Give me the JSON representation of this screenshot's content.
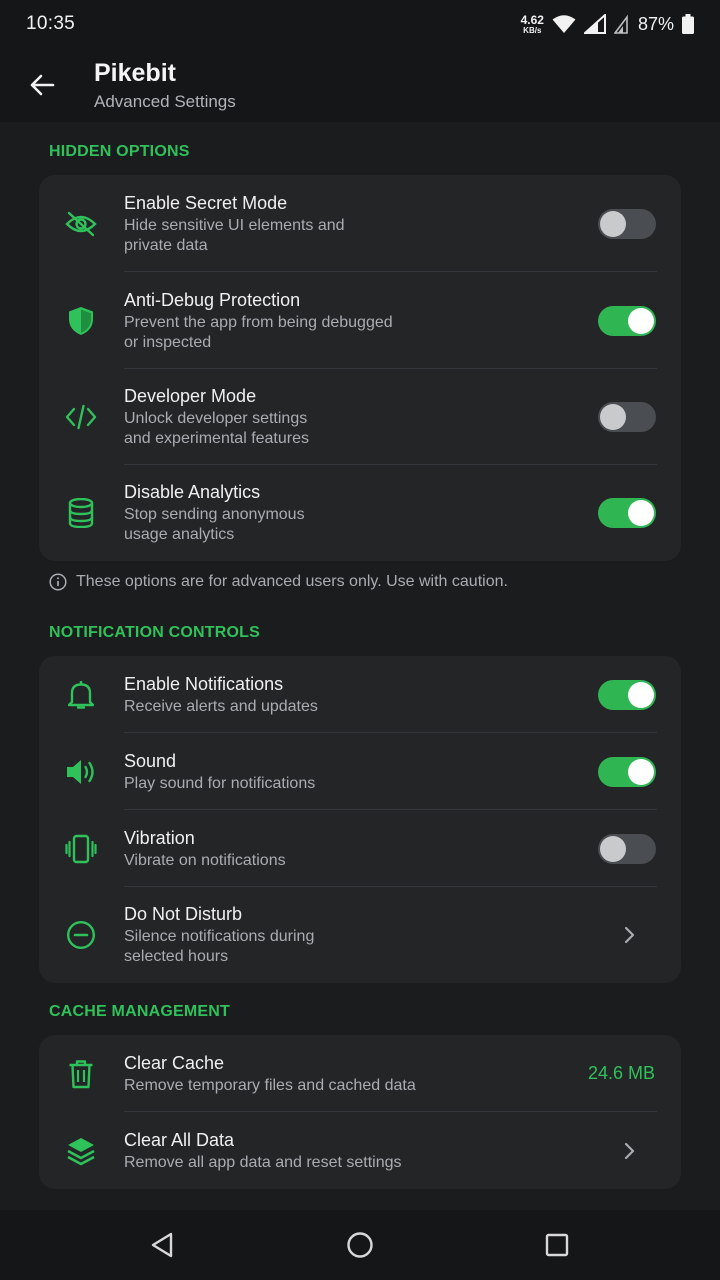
{
  "status": {
    "time": "10:35",
    "net_speed_value": "4.62",
    "net_speed_unit": "KB/s",
    "battery": "87%"
  },
  "appbar": {
    "title": "Pikebit",
    "subtitle": "Advanced Settings"
  },
  "hidden_options": {
    "header": "HIDDEN OPTIONS",
    "items": [
      {
        "label": "Enable Secret Mode",
        "desc1": "Hide sensitive UI elements and",
        "desc2": "private data",
        "icon": "eye-off-icon",
        "enabled": false
      },
      {
        "label": "Anti-Debug Protection",
        "desc1": "Prevent the app from being debugged",
        "desc2": "or inspected",
        "icon": "shield-icon",
        "enabled": true
      },
      {
        "label": "Developer Mode",
        "desc1": "Unlock developer settings",
        "desc2": "and experimental features",
        "icon": "code-icon",
        "enabled": false
      },
      {
        "label": "Disable Analytics",
        "desc1": "Stop sending anonymous",
        "desc2": "usage analytics",
        "icon": "database-icon",
        "enabled": true
      }
    ],
    "note": "These options are for advanced users only. Use with caution."
  },
  "notification_controls": {
    "header": "NOTIFICATION CONTROLS",
    "items": [
      {
        "label": "Enable Notifications",
        "desc1": "Receive alerts and updates",
        "icon": "bell-icon",
        "enabled": true
      },
      {
        "label": "Sound",
        "desc1": "Play sound for notifications",
        "icon": "speaker-icon",
        "enabled": true
      },
      {
        "label": "Vibration",
        "desc1": "Vibrate on notifications",
        "icon": "vibration-icon",
        "enabled": false
      },
      {
        "label": "Do Not Disturb",
        "desc1": "Silence notifications during",
        "desc2": "selected hours",
        "icon": "do-not-disturb-icon"
      }
    ]
  },
  "cache_management": {
    "header": "CACHE MANAGEMENT",
    "items": [
      {
        "label": "Clear Cache",
        "desc1": "Remove temporary files and cached data",
        "value": "24.6 MB",
        "icon": "trash-icon"
      },
      {
        "label": "Clear All Data",
        "desc1": "Remove all app data and reset settings",
        "icon": "layers-icon"
      }
    ]
  },
  "colors": {
    "accent": "#2fc15a",
    "background": "#1a1c1e",
    "card": "#232527"
  }
}
